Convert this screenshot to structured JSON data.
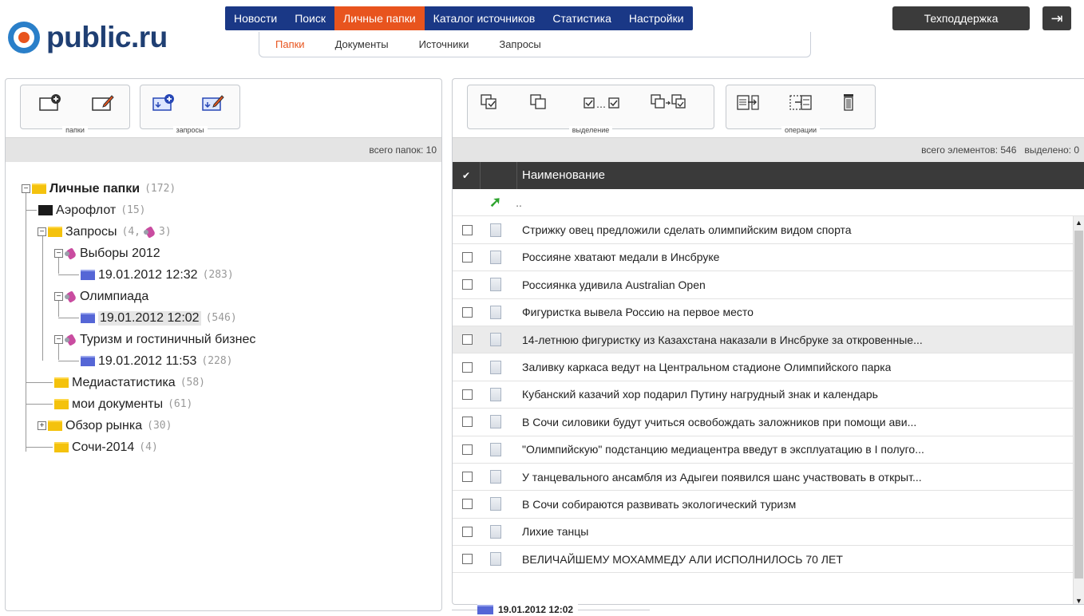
{
  "logo": {
    "text": "public.ru"
  },
  "main_nav": [
    "Новости",
    "Поиск",
    "Личные папки",
    "Каталог источников",
    "Статистика",
    "Настройки"
  ],
  "support_label": "Техподдержка",
  "sub_nav": [
    "Папки",
    "Документы",
    "Источники",
    "Запросы"
  ],
  "left": {
    "toolbar": {
      "group1_label": "папки",
      "group2_label": "запросы"
    },
    "folder_count": "всего папок: 10",
    "tree": {
      "root": {
        "label": "Личные папки",
        "count": "(172)"
      },
      "aeroflot": {
        "label": "Аэрофлот",
        "count": "(15)"
      },
      "zaprosy": {
        "label": "Запросы",
        "count": "(4,",
        "count2": "3)"
      },
      "vybory": {
        "label": "Выборы 2012"
      },
      "vybory_date": {
        "label": "19.01.2012 12:32",
        "count": "(283)"
      },
      "olimp": {
        "label": "Олимпиада"
      },
      "olimp_date": {
        "label": "19.01.2012 12:02",
        "count": "(546)"
      },
      "turizm": {
        "label": "Туризм и гостиничный бизнес"
      },
      "turizm_date": {
        "label": "19.01.2012 11:53",
        "count": "(228)"
      },
      "media": {
        "label": "Медиастатистика",
        "count": "(58)"
      },
      "moi": {
        "label": "мои документы",
        "count": "(61)"
      },
      "obzor": {
        "label": "Обзор рынка",
        "count": "(30)"
      },
      "sochi": {
        "label": "Сочи-2014",
        "count": "(4)"
      }
    }
  },
  "right": {
    "toolbar": {
      "group1_label": "выделение",
      "group2_label": "операции"
    },
    "counts": "всего элементов: 546   выделено: 0",
    "column_title": "Наименование",
    "up_label": "..",
    "rows": [
      "Стрижку овец предложили сделать олимпийским видом спорта",
      "Россияне хватают медали в Инсбруке",
      "Россиянка удивила Australian Open",
      "Фигуристка вывела Россию на первое место",
      "14-летнюю фигуристку из Казахстана наказали в Инсбруке за откровенные...",
      "Заливку каркаса ведут на Центральном стадионе Олимпийского парка",
      "Кубанский казачий хор подарил Путину нагрудный знак и календарь",
      "В Сочи силовики будут учиться освобождать заложников при помощи ави...",
      "\"Олимпийскую\" подстанцию медиацентра введут в эксплуатацию в I полуго...",
      "У танцевального ансамбля из Адыгеи появился шанс участвовать в открыт...",
      "В Сочи собираются развивать экологический туризм",
      "Лихие танцы",
      "ВЕЛИЧАЙШЕМУ МОХАММЕДУ АЛИ ИСПОЛНИЛОСЬ 70 ЛЕТ"
    ],
    "footer_date": "19.01.2012 12:02"
  }
}
